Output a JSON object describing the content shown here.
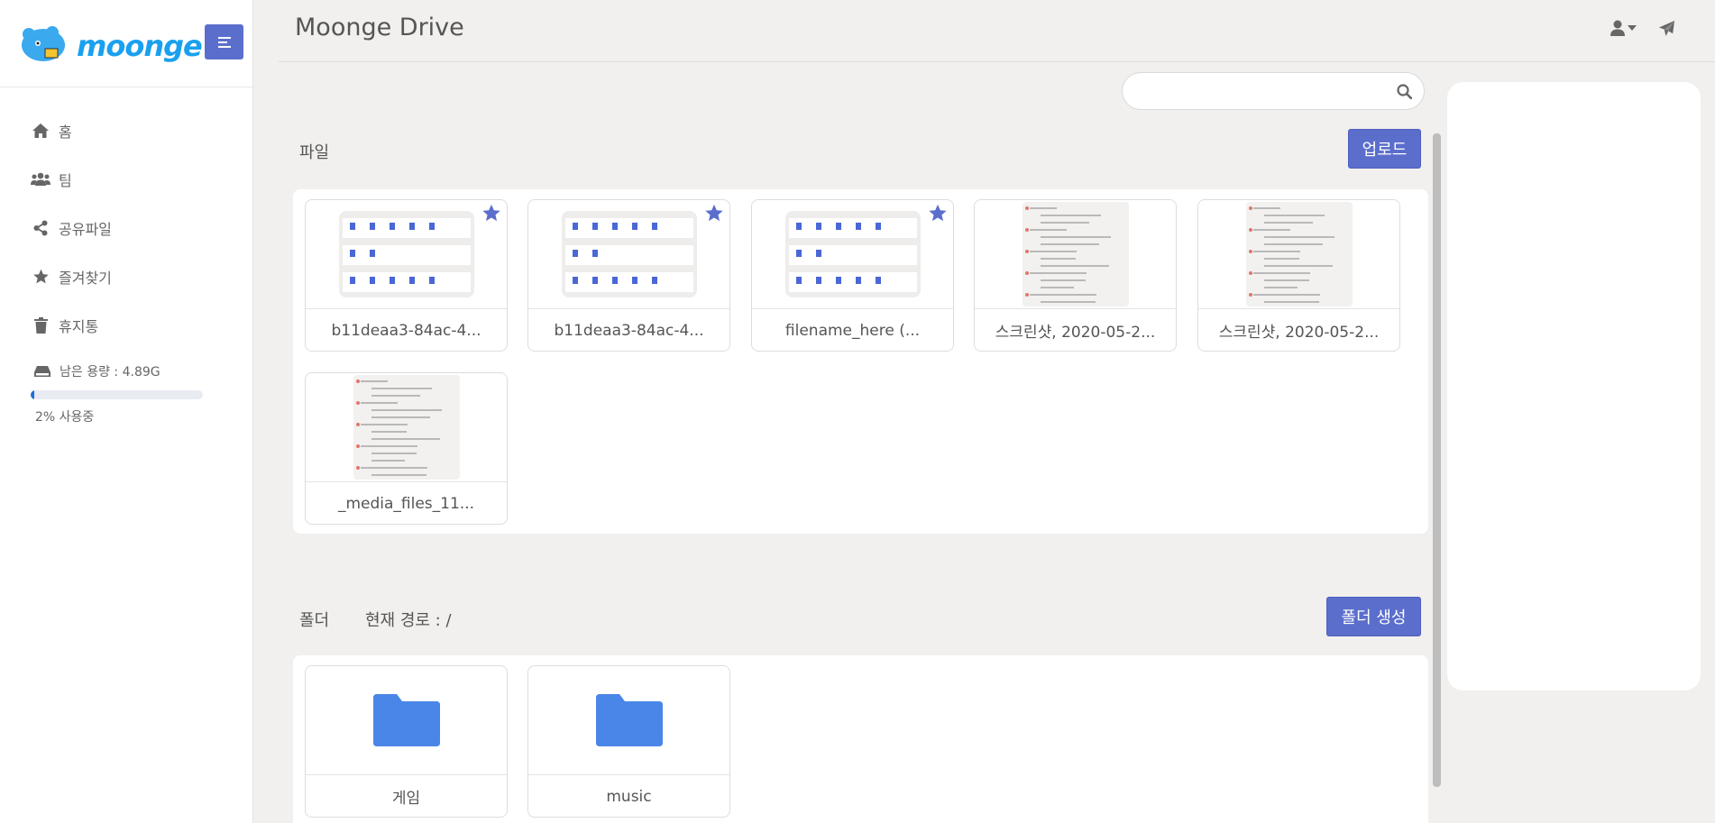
{
  "app": {
    "logo_text": "moonge",
    "title": "Moonge Drive"
  },
  "sidebar": {
    "items": [
      {
        "label": "홈",
        "icon": "home-icon"
      },
      {
        "label": "팀",
        "icon": "team-icon"
      },
      {
        "label": "공유파일",
        "icon": "share-icon"
      },
      {
        "label": "즐겨찾기",
        "icon": "star-icon"
      },
      {
        "label": "휴지통",
        "icon": "trash-icon"
      }
    ],
    "storage": {
      "remaining_label": "남은 용량 : 4.89G",
      "usage_label": "2% 사용중",
      "usage_percent": 2
    }
  },
  "search": {
    "placeholder": "",
    "value": ""
  },
  "files": {
    "label": "파일",
    "upload_label": "업로드",
    "items": [
      {
        "name": "b11deaa3-84ac-4...",
        "thumb": "grid",
        "starred": true
      },
      {
        "name": "b11deaa3-84ac-4...",
        "thumb": "grid",
        "starred": true
      },
      {
        "name": "filename_here (...",
        "thumb": "grid",
        "starred": true
      },
      {
        "name": "스크린샷, 2020-05-2...",
        "thumb": "chat",
        "starred": false
      },
      {
        "name": "스크린샷, 2020-05-2...",
        "thumb": "chat",
        "starred": false
      },
      {
        "name": "_media_files_11...",
        "thumb": "chat",
        "starred": false
      }
    ]
  },
  "folders": {
    "label": "폴더",
    "path_label": "현재 경로 : /",
    "create_label": "폴더 생성",
    "items": [
      {
        "name": "게임"
      },
      {
        "name": "music"
      }
    ]
  },
  "colors": {
    "accent": "#5b6ecc",
    "folder": "#4a86e8",
    "progress": "#1b6fe0",
    "background": "#f1f0ee"
  }
}
